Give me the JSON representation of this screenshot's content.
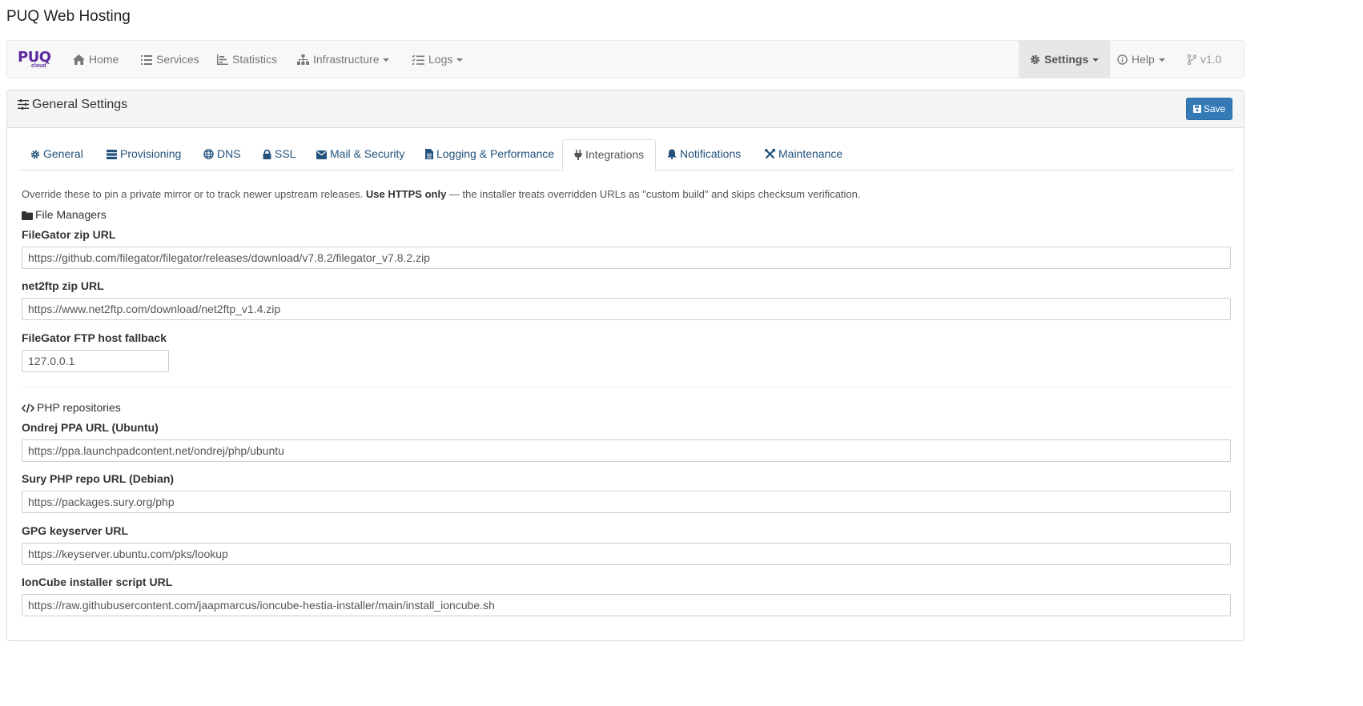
{
  "app": {
    "title": "PUQ Web Hosting"
  },
  "brand": {
    "logo_text": "PUQ",
    "logo_sub": "cloud",
    "color": "#5b2ca0"
  },
  "nav": {
    "home": "Home",
    "services": "Services",
    "statistics": "Statistics",
    "infrastructure": "Infrastructure",
    "logs": "Logs",
    "settings": "Settings",
    "help": "Help",
    "version": "v1.0"
  },
  "panel": {
    "title": "General Settings",
    "save_label": "Save"
  },
  "tabs": [
    {
      "label": "General",
      "icon": "gear-icon"
    },
    {
      "label": "Provisioning",
      "icon": "server-icon"
    },
    {
      "label": "DNS",
      "icon": "globe-icon"
    },
    {
      "label": "SSL",
      "icon": "lock-icon"
    },
    {
      "label": "Mail & Security",
      "icon": "envelope-icon"
    },
    {
      "label": "Logging & Performance",
      "icon": "file-icon"
    },
    {
      "label": "Integrations",
      "icon": "plug-icon",
      "active": true
    },
    {
      "label": "Notifications",
      "icon": "bell-icon"
    },
    {
      "label": "Maintenance",
      "icon": "tools-icon"
    }
  ],
  "intro": {
    "text_before": "Override these to pin a private mirror or to track newer upstream releases. ",
    "bold": "Use HTTPS only",
    "text_after": " — the installer treats overridden URLs as \"custom build\" and skips checksum verification."
  },
  "file_managers": {
    "heading": "File Managers",
    "fields": [
      {
        "label": "FileGator zip URL",
        "value": "https://github.com/filegator/filegator/releases/download/v7.8.2/filegator_v7.8.2.zip"
      },
      {
        "label": "net2ftp zip URL",
        "value": "https://www.net2ftp.com/download/net2ftp_v1.4.zip"
      },
      {
        "label": "FileGator FTP host fallback",
        "value": "127.0.0.1"
      }
    ]
  },
  "php_repositories": {
    "heading": "PHP repositories",
    "fields": [
      {
        "label": "Ondrej PPA URL (Ubuntu)",
        "value": "https://ppa.launchpadcontent.net/ondrej/php/ubuntu"
      },
      {
        "label": "Sury PHP repo URL (Debian)",
        "value": "https://packages.sury.org/php"
      },
      {
        "label": "GPG keyserver URL",
        "value": "https://keyserver.ubuntu.com/pks/lookup"
      },
      {
        "label": "IonCube installer script URL",
        "value": "https://raw.githubusercontent.com/jaapmarcus/ioncube-hestia-installer/main/install_ioncube.sh"
      }
    ]
  },
  "colors": {
    "primary": "#337ab7",
    "link": "#23527c",
    "nav_text": "#777777"
  }
}
